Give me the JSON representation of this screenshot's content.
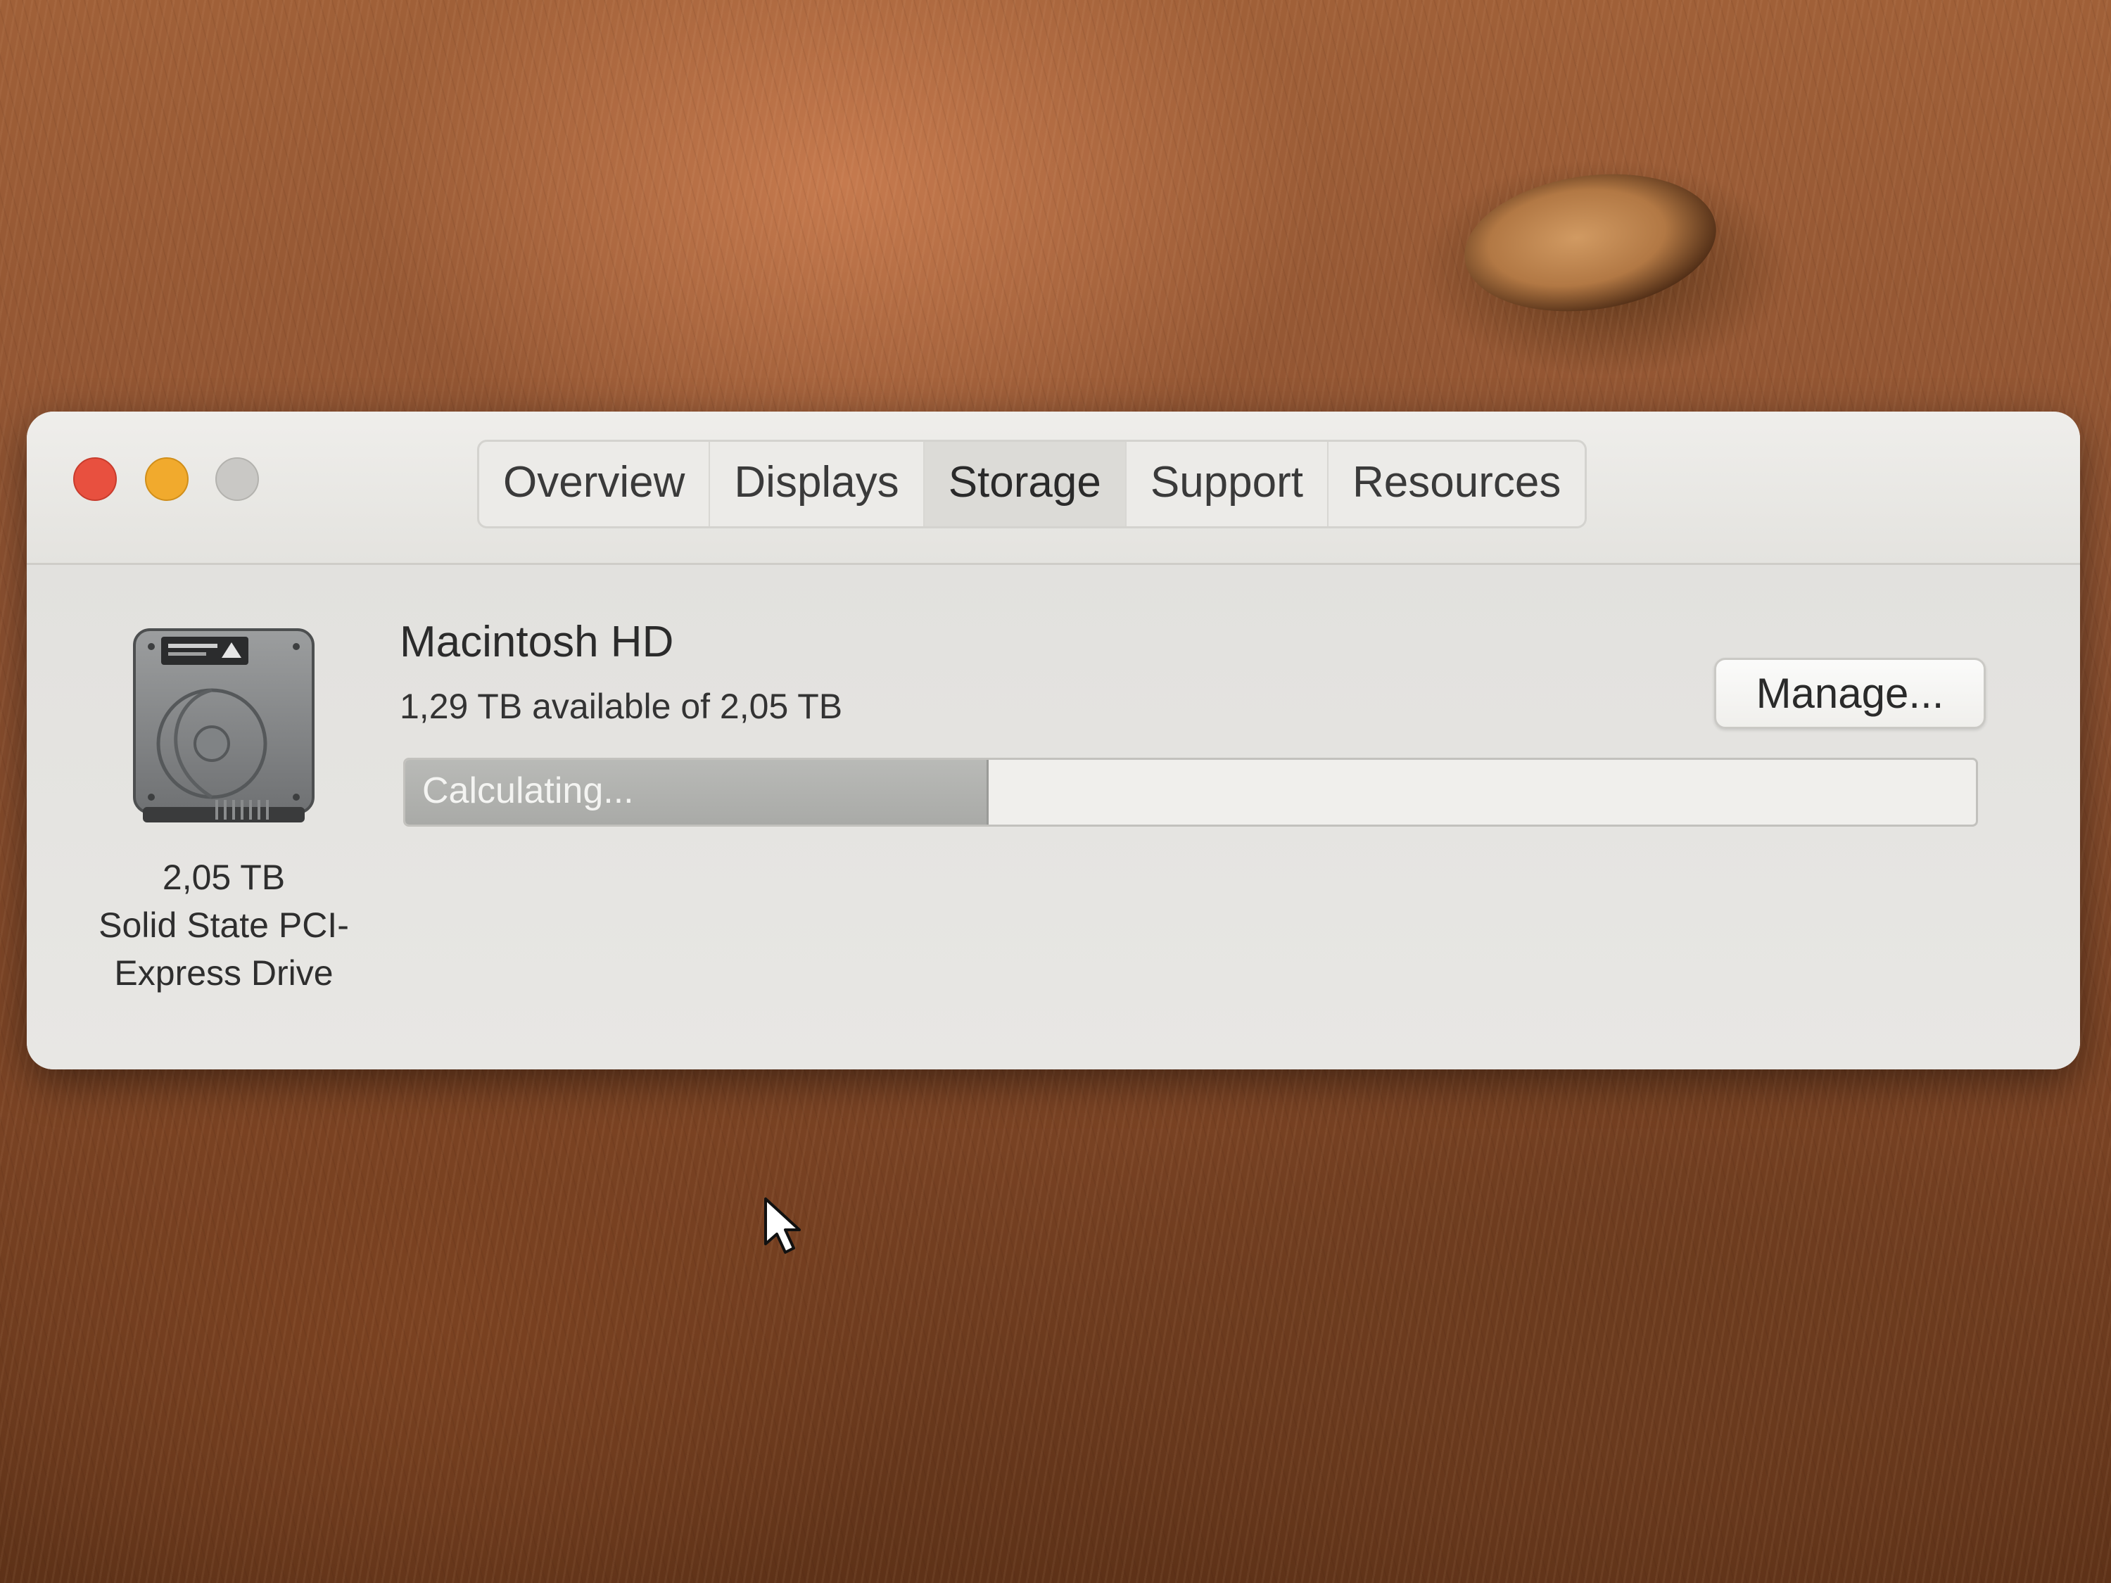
{
  "window": {
    "traffic_lights": {
      "close_color": "#e8503f",
      "minimize_color": "#f1aa2d",
      "zoom_color": "#c9c8c5"
    },
    "tabs": [
      {
        "label": "Overview",
        "active": false
      },
      {
        "label": "Displays",
        "active": false
      },
      {
        "label": "Storage",
        "active": true
      },
      {
        "label": "Support",
        "active": false
      },
      {
        "label": "Resources",
        "active": false
      }
    ]
  },
  "disk": {
    "icon": "internal-drive-icon",
    "capacity": "2,05 TB",
    "type_line_1": "Solid State PCI-",
    "type_line_2": "Express Drive"
  },
  "volume": {
    "name": "Macintosh HD",
    "availability": "1,29 TB available of 2,05 TB",
    "manage_label": "Manage...",
    "storage_bar_label": "Calculating...",
    "storage_bar_fill_fraction": 0.37
  },
  "desktop": {
    "wallpaper": "lion-fur-wallpaper",
    "cursor_icon": "arrow-cursor-icon"
  }
}
